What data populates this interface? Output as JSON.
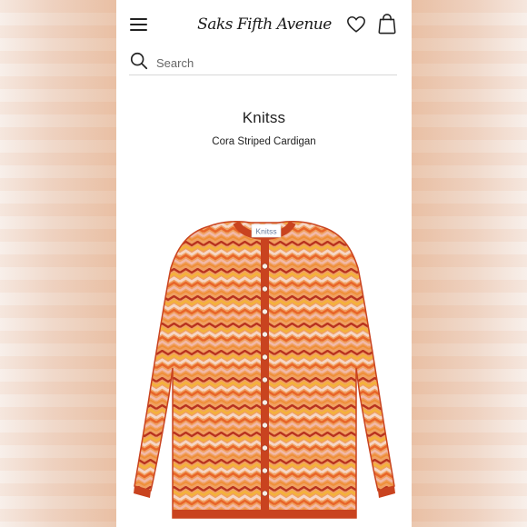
{
  "header": {
    "logo_text": "Saks Fifth Avenue",
    "icons": [
      "menu-icon",
      "heart-icon",
      "shopping-bag-icon"
    ]
  },
  "search": {
    "placeholder": "Search",
    "icon": "search-icon"
  },
  "product": {
    "brand": "Knitss",
    "name": "Cora Striped Cardigan",
    "label_tag": "Knitss"
  },
  "colors": {
    "background": "#ffffff",
    "text": "#222222",
    "cardigan_orange": "#e8662a",
    "cardigan_trim": "#c9431f",
    "stripe_yellow": "#f4b23a",
    "stripe_pink": "#f2b9a7",
    "stripe_red": "#b8321e",
    "side_blur": "#e9c5ad"
  }
}
